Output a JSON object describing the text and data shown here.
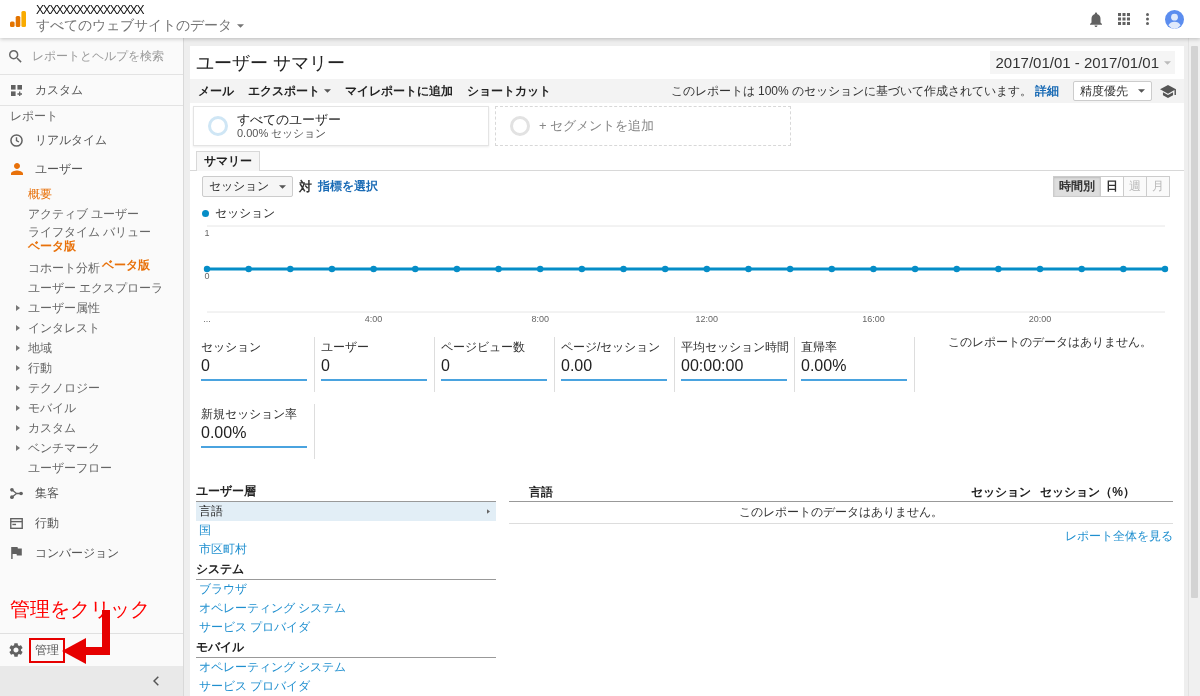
{
  "topbar": {
    "account": "XXXXXXXXXXXXXXXX",
    "view": "すべてのウェブサイトのデータ"
  },
  "sidebar": {
    "search": {
      "placeholder": "レポートとヘルプを検索"
    },
    "top_items": [
      {
        "label": "カスタム",
        "selected": false
      }
    ],
    "section_label": "レポート",
    "items": [
      {
        "label": "リアルタイム",
        "selected": false
      },
      {
        "label": "ユーザー",
        "selected": true,
        "children": [
          {
            "kind": "page",
            "label": "概要",
            "selected": true
          },
          {
            "kind": "page",
            "label": "アクティブ ユーザー",
            "selected": false
          },
          {
            "kind": "page",
            "label": "ライフタイム バリュー",
            "badge": "ベータ版",
            "selected": false
          },
          {
            "kind": "page",
            "label": "コホート分析",
            "badge": "ベータ版",
            "selected": false
          },
          {
            "kind": "page",
            "label": "ユーザー エクスプローラ",
            "selected": false
          },
          {
            "kind": "group",
            "label": "ユーザー属性",
            "selected": false,
            "expanded": false
          },
          {
            "kind": "group",
            "label": "インタレスト",
            "selected": false,
            "expanded": false
          },
          {
            "kind": "group",
            "label": "地域",
            "selected": false,
            "expanded": false
          },
          {
            "kind": "group",
            "label": "行動",
            "selected": false,
            "expanded": false
          },
          {
            "kind": "group",
            "label": "テクノロジー",
            "selected": false,
            "expanded": false
          },
          {
            "kind": "group",
            "label": "モバイル",
            "selected": false,
            "expanded": false
          },
          {
            "kind": "group",
            "label": "カスタム",
            "selected": false,
            "expanded": false
          },
          {
            "kind": "group",
            "label": "ベンチマーク",
            "selected": false,
            "expanded": false
          },
          {
            "kind": "page",
            "label": "ユーザーフロー",
            "selected": false
          }
        ]
      },
      {
        "label": "集客",
        "selected": false
      },
      {
        "label": "行動",
        "selected": false
      },
      {
        "label": "コンバージョン",
        "selected": false
      }
    ],
    "annotation": "管理をクリック",
    "admin": {
      "label": "管理",
      "highlighted": true
    }
  },
  "report": {
    "title": "ユーザー サマリー",
    "date_range": "2017/01/01 - 2017/01/01",
    "actions": [
      {
        "label": "メール",
        "dropdown": false
      },
      {
        "label": "エクスポート",
        "dropdown": true
      },
      {
        "label": "マイレポートに追加",
        "dropdown": false
      },
      {
        "label": "ショートカット",
        "dropdown": false
      }
    ],
    "sampling": {
      "note": "このレポートは 100% のセッションに基づいて作成されています。",
      "link": "詳細",
      "precision": "精度優先"
    },
    "segments": [
      {
        "kind": "segment",
        "name": "すべてのユーザー",
        "detail": "0.00% セッション"
      },
      {
        "kind": "add",
        "name": "+ セグメントを追加"
      }
    ],
    "tabs": [
      {
        "label": "サマリー",
        "selected": true
      }
    ],
    "metric_picker": {
      "value": "セッション",
      "versus": "対",
      "link": "指標を選択"
    },
    "granularity": [
      {
        "label": "時間別",
        "selected": true,
        "disabled": false
      },
      {
        "label": "日",
        "selected": false,
        "disabled": false
      },
      {
        "label": "週",
        "selected": false,
        "disabled": true
      },
      {
        "label": "月",
        "selected": false,
        "disabled": true
      }
    ],
    "chart": {
      "chart_data": {
        "type": "line",
        "x": [
          0,
          1,
          2,
          3,
          4,
          5,
          6,
          7,
          8,
          9,
          10,
          11,
          12,
          13,
          14,
          15,
          16,
          17,
          18,
          19,
          20,
          21,
          22,
          23
        ],
        "xlim": [
          0,
          23
        ],
        "ylim": [
          -1,
          1
        ],
        "yticks": [
          0,
          1
        ],
        "xticks": [
          {
            "value": 0,
            "label": "..."
          },
          {
            "value": 4,
            "label": "4:00"
          },
          {
            "value": 8,
            "label": "8:00"
          },
          {
            "value": 12,
            "label": "12:00"
          },
          {
            "value": 16,
            "label": "16:00"
          },
          {
            "value": 20,
            "label": "20:00"
          }
        ],
        "series": [
          {
            "name": "セッション",
            "color": "#058dc7",
            "marker": true,
            "values": [
              0,
              0,
              0,
              0,
              0,
              0,
              0,
              0,
              0,
              0,
              0,
              0,
              0,
              0,
              0,
              0,
              0,
              0,
              0,
              0,
              0,
              0,
              0,
              0
            ]
          }
        ]
      }
    },
    "metrics": [
      {
        "label": "セッション",
        "value": "0"
      },
      {
        "label": "ユーザー",
        "value": "0"
      },
      {
        "label": "ページビュー数",
        "value": "0"
      },
      {
        "label": "ページ/セッション",
        "value": "0.00"
      },
      {
        "label": "平均セッション時間",
        "value": "00:00:00"
      },
      {
        "label": "直帰率",
        "value": "0.00%"
      },
      {
        "label": "新規セッション率",
        "value": "0.00%"
      }
    ],
    "no_data_note": "このレポートのデータはありません。",
    "dimension_groups": [
      {
        "title": "ユーザー層",
        "items": [
          {
            "label": "言語",
            "selected": true
          },
          {
            "label": "国",
            "selected": false
          },
          {
            "label": "市区町村",
            "selected": false
          }
        ]
      },
      {
        "title": "システム",
        "items": [
          {
            "label": "ブラウザ",
            "selected": false
          },
          {
            "label": "オペレーティング システム",
            "selected": false
          },
          {
            "label": "サービス プロバイダ",
            "selected": false
          }
        ]
      },
      {
        "title": "モバイル",
        "items": [
          {
            "label": "オペレーティング システム",
            "selected": false
          },
          {
            "label": "サービス プロバイダ",
            "selected": false
          }
        ]
      }
    ],
    "table": {
      "columns": [
        "言語",
        "セッション",
        "セッション（%）"
      ],
      "empty_message": "このレポートのデータはありません。",
      "link": "レポート全体を見る"
    }
  }
}
